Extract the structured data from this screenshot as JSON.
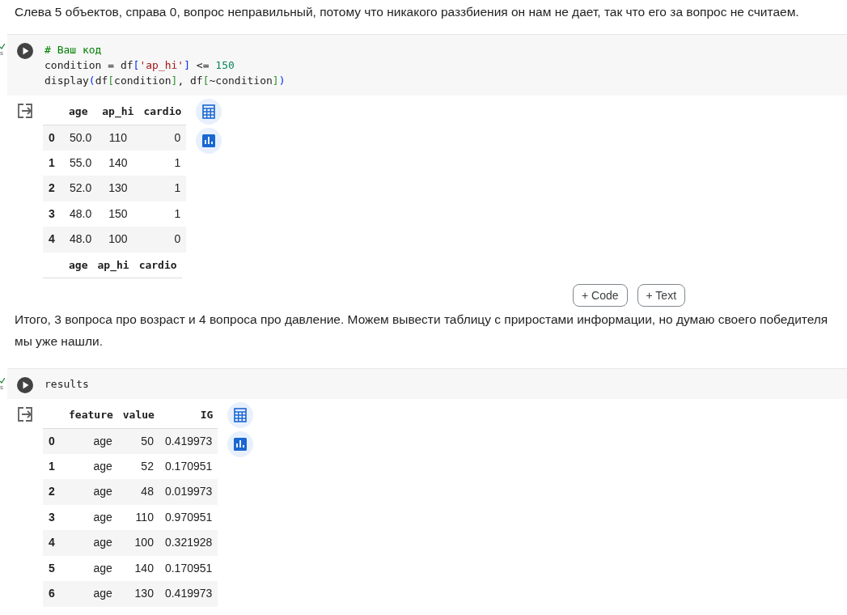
{
  "intro_text": "Слева 5 объектов, справа 0, вопрос неправильный, потому что никакого раззбиения он нам не дает, так что его за вопрос не считаем.",
  "cells": [
    {
      "kind": "code",
      "status_fragment": "s",
      "code_lines": [
        [
          {
            "kind": "comment",
            "text": "# Ваш код"
          }
        ],
        [
          {
            "kind": "plain",
            "text": "condition = df"
          },
          {
            "kind": "bracket",
            "text": "["
          },
          {
            "kind": "string",
            "text": "'ap_hi'"
          },
          {
            "kind": "bracket",
            "text": "]"
          },
          {
            "kind": "plain",
            "text": " <= "
          },
          {
            "kind": "number",
            "text": "150"
          }
        ],
        [
          {
            "kind": "plain",
            "text": "display"
          },
          {
            "kind": "bracket",
            "text": "("
          },
          {
            "kind": "plain",
            "text": "df"
          },
          {
            "kind": "bracket2",
            "text": "["
          },
          {
            "kind": "plain",
            "text": "condition"
          },
          {
            "kind": "bracket2",
            "text": "]"
          },
          {
            "kind": "plain",
            "text": ", df"
          },
          {
            "kind": "bracket2",
            "text": "["
          },
          {
            "kind": "plain",
            "text": "~condition"
          },
          {
            "kind": "bracket2",
            "text": "]"
          },
          {
            "kind": "bracket",
            "text": ")"
          }
        ]
      ],
      "outputs": [
        {
          "kind": "mixed",
          "columns": [
            "age",
            "ap_hi",
            "cardio"
          ],
          "rows": [
            {
              "index": "0",
              "cells": [
                "50.0",
                "110",
                "0"
              ]
            },
            {
              "index": "1",
              "cells": [
                "55.0",
                "140",
                "1"
              ]
            },
            {
              "index": "2",
              "cells": [
                "52.0",
                "130",
                "1"
              ]
            },
            {
              "index": "3",
              "cells": [
                "48.0",
                "150",
                "1"
              ]
            },
            {
              "index": "4",
              "cells": [
                "48.0",
                "100",
                "0"
              ]
            }
          ]
        },
        {
          "kind": "mixed",
          "columns": [
            "age",
            "ap_hi",
            "cardio"
          ]
        }
      ]
    },
    {
      "kind": "buttons",
      "buttons": [
        "+ Code",
        "+ Text"
      ]
    },
    {
      "kind": "text",
      "text": "Итого, 3 вопроса про возраст и 4 вопроса про давление. Можем вывести таблицу с приростами информации, но думаю своего победителя мы уже нашли."
    },
    {
      "kind": "code",
      "status_fragment": "s",
      "code_lines": [
        [
          {
            "kind": "plain",
            "text": "results"
          }
        ]
      ],
      "outputs": [
        {
          "kind": "numeric",
          "columns": [
            "feature",
            "value",
            "IG"
          ],
          "rows": [
            {
              "index": "0",
              "cells": [
                "age",
                "50",
                "0.419973"
              ]
            },
            {
              "index": "1",
              "cells": [
                "age",
                "52",
                "0.170951"
              ]
            },
            {
              "index": "2",
              "cells": [
                "age",
                "48",
                "0.019973"
              ]
            },
            {
              "index": "3",
              "cells": [
                "age",
                "110",
                "0.970951"
              ]
            },
            {
              "index": "4",
              "cells": [
                "age",
                "100",
                "0.321928"
              ]
            },
            {
              "index": "5",
              "cells": [
                "age",
                "140",
                "0.170951"
              ]
            },
            {
              "index": "6",
              "cells": [
                "age",
                "130",
                "0.419973"
              ]
            }
          ]
        }
      ]
    }
  ]
}
